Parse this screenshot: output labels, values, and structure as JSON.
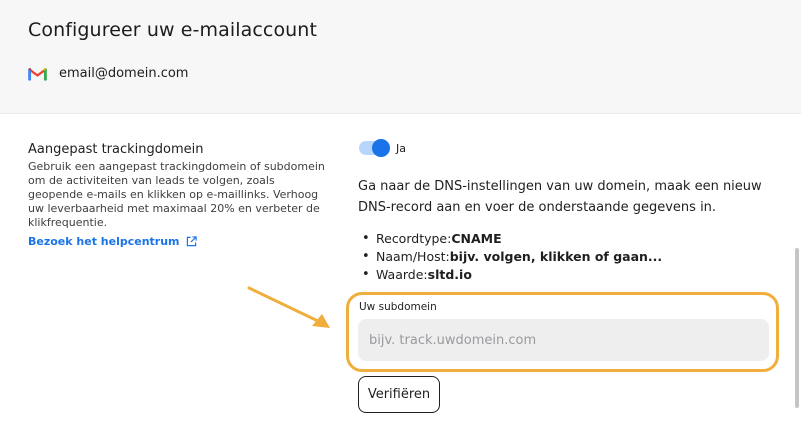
{
  "header": {
    "title": "Configureer uw e-mailaccount",
    "account_icon": "gmail-icon",
    "account_email": "email@domein.com"
  },
  "tracking": {
    "title": "Aangepast trackingdomein",
    "description": "Gebruik een aangepast trackingdomein of subdomein om de activiteiten van leads te volgen, zoals geopende e-mails en klikken op e-maillinks. Verhoog uw leverbaarheid met maximaal 20% en verbeter de klikfrequentie.",
    "help_link": "Bezoek het helpcentrum",
    "help_icon": "external-link-icon",
    "toggle_state": "on",
    "toggle_label": "Ja",
    "instruction": "Ga naar de DNS-instellingen van uw domein, maak een nieuw DNS-record aan en voer de onderstaande gegevens in.",
    "records": [
      {
        "label": "Recordtype: ",
        "value": "CNAME"
      },
      {
        "label": "Naam/Host: ",
        "value": "bijv. volgen, klikken of gaan..."
      },
      {
        "label": "Waarde: ",
        "value": "sltd.io"
      }
    ],
    "subdomain_label": "Uw subdomein",
    "subdomain_placeholder": "bijv. track.uwdomein.com",
    "subdomain_value": "",
    "verify_button": "Verifiëren"
  },
  "colors": {
    "accent": "#1a73e8",
    "highlight": "#f0ae3c",
    "header_bg": "#f7f7f8"
  }
}
